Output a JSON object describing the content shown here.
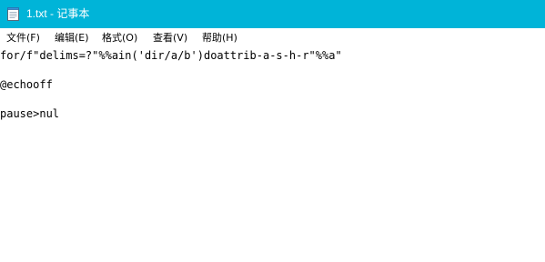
{
  "window": {
    "title": "1.txt - 记事本",
    "accent_color": "#00b4d8",
    "icon": "notepad-icon"
  },
  "menu": {
    "items": [
      "文件(F)",
      "编辑(E)",
      "格式(O)",
      "查看(V)",
      "帮助(H)"
    ]
  },
  "editor": {
    "lines": [
      "for/f\"delims=?\"%%ain('dir/a/b')doattrib-a-s-h-r\"%%a\"",
      "",
      "@echooff",
      "",
      "pause>nul"
    ]
  }
}
